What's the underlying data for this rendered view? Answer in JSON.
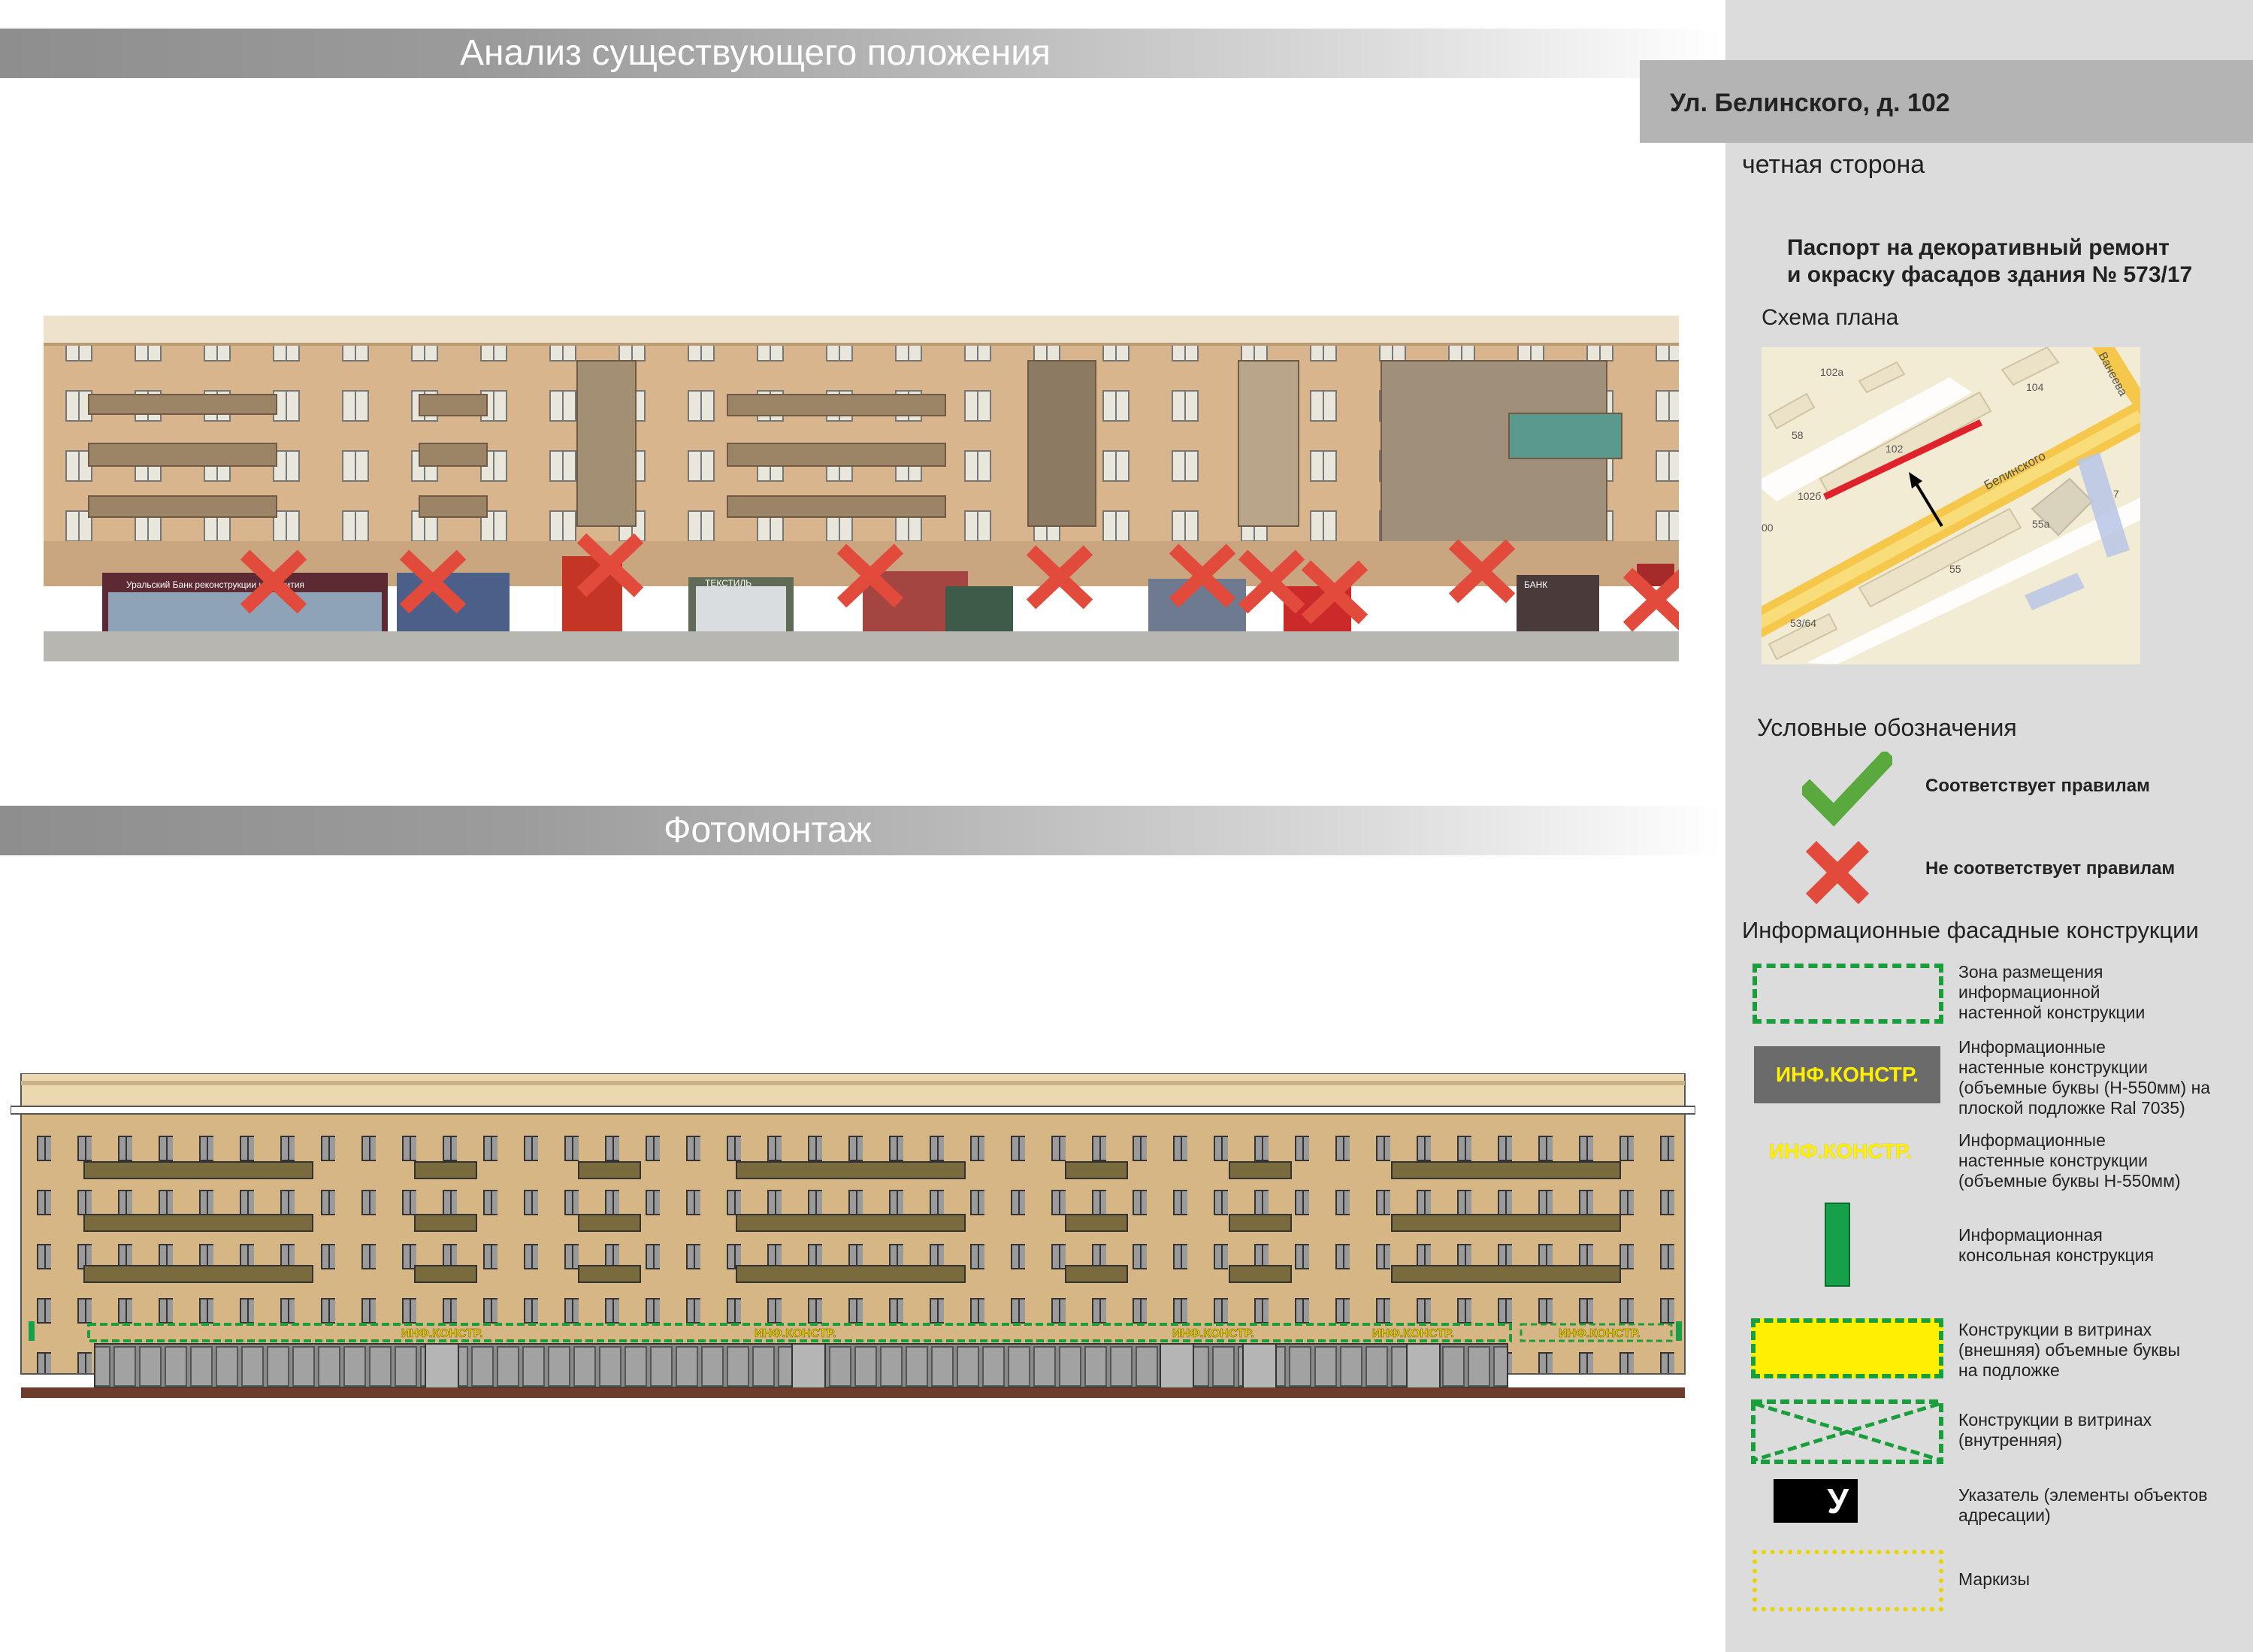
{
  "headers": {
    "analysis": "Анализ существующего положения",
    "photomontage": "Фотомонтаж"
  },
  "address": "Ул. Белинского, д. 102",
  "side": "четная сторона",
  "passport": {
    "line1": "Паспорт на декоративный ремонт",
    "line2": "и окраску фасадов здания № 573/17"
  },
  "plan_scheme": {
    "title": "Схема плана",
    "labels": [
      "102а",
      "104",
      "58",
      "102",
      "102б",
      "Белинского",
      "Ванеева",
      "55а",
      "7",
      "55",
      "53/64",
      "00"
    ]
  },
  "legend": {
    "title": "Условные обозначения",
    "complies": "Соответствует правилам",
    "not_complies": "Не соответствует правилам"
  },
  "info_constructions": {
    "title": "Информационные фасадные конструкции",
    "items": [
      {
        "name": "zone",
        "lines": [
          "Зона размещения",
          "информационной",
          "настенной конструкции"
        ]
      },
      {
        "name": "letters-on-backing",
        "sample": "ИНФ.КОНСТР.",
        "lines": [
          "Информационные",
          "настенные конструкции",
          "(объемные буквы (H-550мм) на",
          "плоской подложке Ral 7035)"
        ]
      },
      {
        "name": "letters",
        "sample": "ИНФ.КОНСТР.",
        "lines": [
          "Информационные",
          "настенные конструкции",
          "(объемные буквы H-550мм)"
        ]
      },
      {
        "name": "console",
        "lines": [
          "Информационная",
          "консольная конструкция"
        ]
      },
      {
        "name": "window-external",
        "lines": [
          "Конструкции в витринах",
          "(внешняя) объемные буквы",
          "на подложке"
        ]
      },
      {
        "name": "window-internal",
        "lines": [
          "Конструкции в витринах",
          "(внутренняя)"
        ]
      },
      {
        "name": "pointer",
        "sample": "У",
        "lines": [
          "Указатель (элементы объектов",
          "адресации)"
        ]
      },
      {
        "name": "awnings",
        "lines": [
          "Маркизы"
        ]
      }
    ]
  },
  "photo": {
    "signs": [
      "Уральский Банк реконструкции и развития",
      "ТЕКСТИЛЬ",
      "БАНК"
    ],
    "marks_count": "11"
  },
  "elevation": {
    "sign_text": "ИНФ.КОНСТР."
  },
  "colors": {
    "banner": "#9a9a9a",
    "panel": "#dcdcdc",
    "address_box": "#b4b4b4",
    "check": "#5aa93f",
    "cross": "#e24a3b",
    "zone_green": "#1a9e3c",
    "yellow": "#ffef00",
    "facade": "#d7b685",
    "balcony": "#7a6b3f"
  },
  "icons": [
    "check-icon",
    "cross-icon",
    "arrow-icon"
  ]
}
